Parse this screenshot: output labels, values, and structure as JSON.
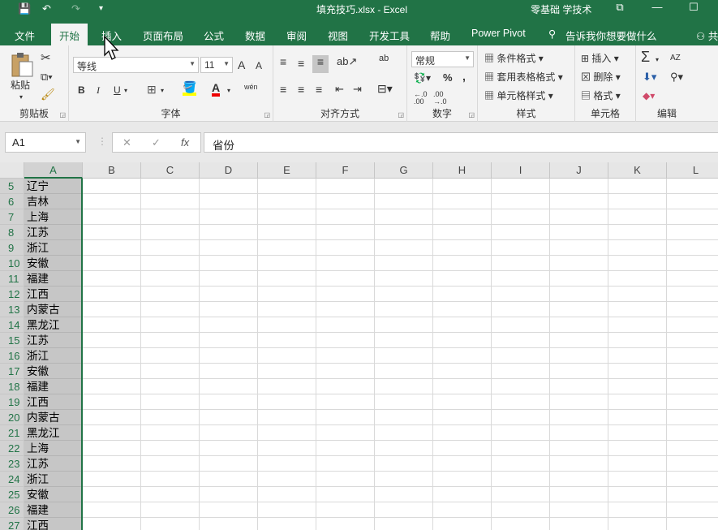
{
  "titlebar": {
    "title": "填充技巧.xlsx  -  Excel",
    "account": "零基础 学技术",
    "save_icon": "💾",
    "undo": "↶",
    "redo": "↷",
    "customize": "▾",
    "restore": "⧉",
    "minimize": "—",
    "maximize": "☐"
  },
  "tabs": [
    {
      "label": "文件"
    },
    {
      "label": "开始"
    },
    {
      "label": "插入"
    },
    {
      "label": "页面布局"
    },
    {
      "label": "公式"
    },
    {
      "label": "数据"
    },
    {
      "label": "审阅"
    },
    {
      "label": "视图"
    },
    {
      "label": "开发工具"
    },
    {
      "label": "帮助"
    },
    {
      "label": "Power Pivot"
    }
  ],
  "tell_me": "告诉我你想要做什么",
  "share": "共",
  "ribbon": {
    "clipboard": {
      "label": "剪贴板",
      "paste": "粘贴"
    },
    "font": {
      "label": "字体",
      "name": "等线",
      "size": "11",
      "grow": "A",
      "shrink": "A",
      "bold": "B",
      "italic": "I",
      "underline": "U",
      "wen": "wén",
      "color_a": "A"
    },
    "alignment": {
      "label": "对齐方式",
      "ab": "ab"
    },
    "number": {
      "label": "数字",
      "format": "常规",
      "percent": "%",
      "comma": ","
    },
    "styles": {
      "label": "样式",
      "cond": "条件格式",
      "table": "套用表格格式",
      "cell": "单元格样式"
    },
    "cells": {
      "label": "单元格",
      "insert": "插入",
      "delete": "删除",
      "format": "格式"
    },
    "editing": {
      "label": "编辑",
      "sum": "Σ",
      "sort": "AZ"
    }
  },
  "formula_bar": {
    "name_box": "A1",
    "cancel": "✕",
    "enter": "✓",
    "fx": "fx",
    "content": "省份"
  },
  "columns": [
    "A",
    "B",
    "C",
    "D",
    "E",
    "F",
    "G",
    "H",
    "I",
    "J",
    "K",
    "L"
  ],
  "rows": [
    {
      "n": "5",
      "a": "辽宁"
    },
    {
      "n": "6",
      "a": "吉林"
    },
    {
      "n": "7",
      "a": "上海"
    },
    {
      "n": "8",
      "a": "江苏"
    },
    {
      "n": "9",
      "a": "浙江"
    },
    {
      "n": "10",
      "a": "安徽"
    },
    {
      "n": "11",
      "a": "福建"
    },
    {
      "n": "12",
      "a": "江西"
    },
    {
      "n": "13",
      "a": "内蒙古"
    },
    {
      "n": "14",
      "a": "黑龙江"
    },
    {
      "n": "15",
      "a": "江苏"
    },
    {
      "n": "16",
      "a": "浙江"
    },
    {
      "n": "17",
      "a": "安徽"
    },
    {
      "n": "18",
      "a": "福建"
    },
    {
      "n": "19",
      "a": "江西"
    },
    {
      "n": "20",
      "a": "内蒙古"
    },
    {
      "n": "21",
      "a": "黑龙江"
    },
    {
      "n": "22",
      "a": "上海"
    },
    {
      "n": "23",
      "a": "江苏"
    },
    {
      "n": "24",
      "a": "浙江"
    },
    {
      "n": "25",
      "a": "安徽"
    },
    {
      "n": "26",
      "a": "福建"
    },
    {
      "n": "27",
      "a": "江西"
    }
  ],
  "colors": {
    "accent": "#217346",
    "selection": "#c6c6c6"
  }
}
